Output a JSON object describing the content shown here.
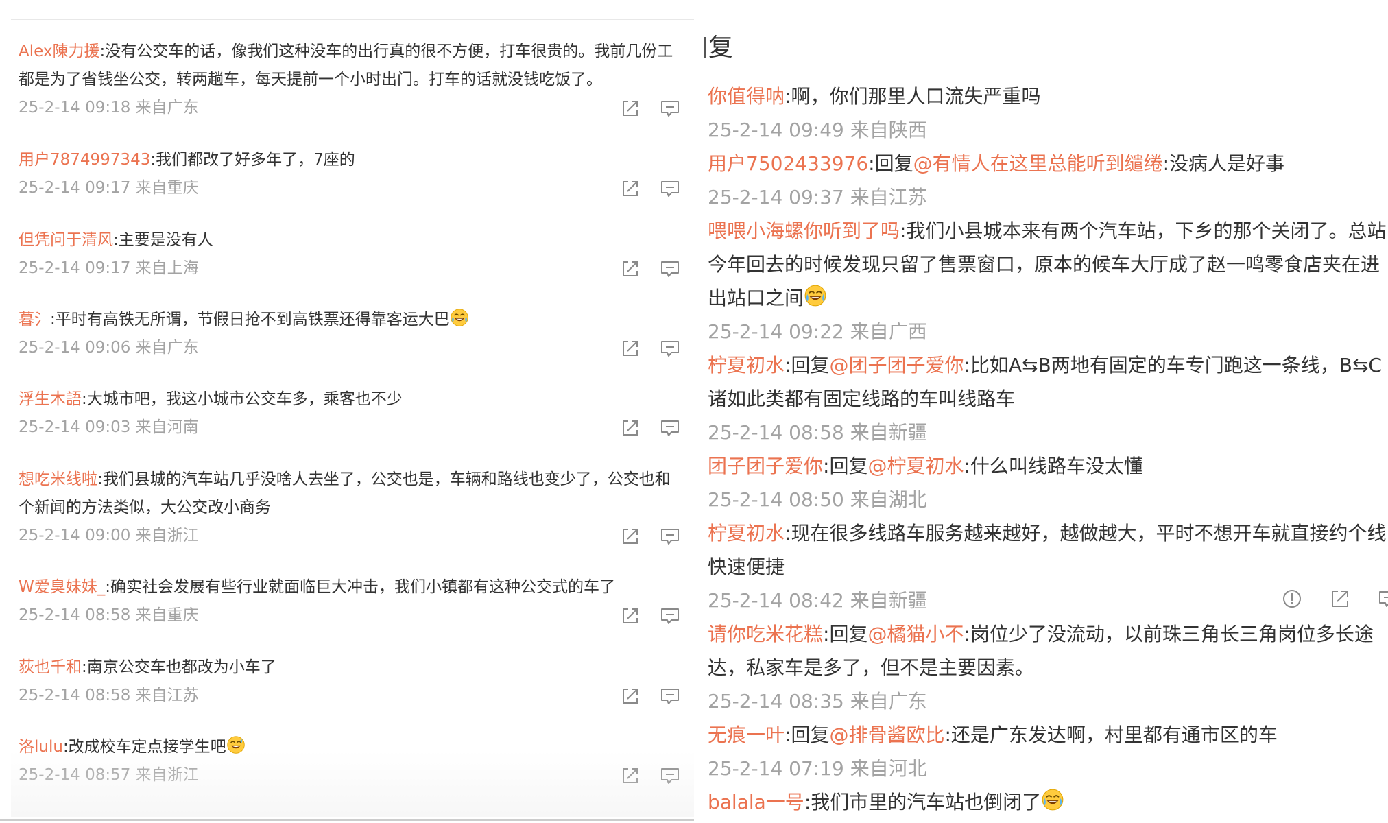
{
  "left_panel": {
    "comments": [
      {
        "user": "Alex陳力援",
        "lines": [
          ":没有公交车的话，像我们这种没车的出行真的很不方便，打车很贵的。我前几份工",
          "都是为了省钱坐公交，转两趟车，每天提前一个小时出门。打车的话就没钱吃饭了。"
        ],
        "meta": "25-2-14 09:18 来自广东"
      },
      {
        "user": "用户7874997343",
        "lines": [
          ":我们都改了好多年了，7座的"
        ],
        "meta": "25-2-14 09:17 来自重庆"
      },
      {
        "user": "但凭问于清风",
        "lines": [
          ":主要是没有人"
        ],
        "meta": "25-2-14 09:17 来自上海"
      },
      {
        "user": "暮氵",
        "lines": [
          ":平时有高铁无所谓，节假日抢不到高铁票还得靠客运大巴"
        ],
        "emoji": "laugh-cry-emoji",
        "meta": "25-2-14 09:06 来自广东"
      },
      {
        "user": "浮生木語",
        "lines": [
          ":大城市吧，我这小城市公交车多，乘客也不少"
        ],
        "meta": "25-2-14 09:03 来自河南"
      },
      {
        "user": "想吃米线啦",
        "lines": [
          ":我们县城的汽车站几乎没啥人去坐了，公交也是，车辆和路线也变少了，公交也和",
          "个新闻的方法类似，大公交改小商务"
        ],
        "meta": "25-2-14 09:00 来自浙江"
      },
      {
        "user": "W爱臭妹妹_",
        "lines": [
          ":确实社会发展有些行业就面临巨大冲击，我们小镇都有这种公交式的车了"
        ],
        "meta": "25-2-14 08:58 来自重庆"
      },
      {
        "user": "荻也千和",
        "lines": [
          ":南京公交车也都改为小车了"
        ],
        "meta": "25-2-14 08:58 来自江苏"
      },
      {
        "user": "洛lulu",
        "lines": [
          ":改成校车定点接学生吧"
        ],
        "emoji": "grin-sweat-emoji",
        "meta": "25-2-14 08:57 来自浙江"
      }
    ]
  },
  "right_panel": {
    "heading": "复",
    "comments": [
      {
        "user": "你值得呐",
        "lines": [
          [
            {
              "t": ":啊，你们那里人口流失严重吗"
            }
          ]
        ],
        "meta": "25-2-14 09:49 来自陕西"
      },
      {
        "user": "用户7502433976",
        "lines": [
          [
            {
              "t": ":回复"
            },
            {
              "t": "@有情人在这里总能听到缱绻",
              "mention": true
            },
            {
              "t": ":没病人是好事"
            }
          ]
        ],
        "meta": "25-2-14 09:37 来自江苏"
      },
      {
        "user": "喂喂小海螺你听到了吗",
        "lines": [
          [
            {
              "t": ":我们小县城本来有两个汽车站，下乡的那个关闭了。总站"
            }
          ],
          [
            {
              "t": "今年回去的时候发现只留了售票窗口，原本的候车大厅成了赵一鸣零食店夹在进"
            }
          ],
          [
            {
              "t": "出站口之间"
            }
          ]
        ],
        "emoji": "laugh-cry-emoji",
        "meta": "25-2-14 09:22 来自广西"
      },
      {
        "user": "柠夏初水",
        "lines": [
          [
            {
              "t": ":回复"
            },
            {
              "t": "@团子团子爱你",
              "mention": true
            },
            {
              "t": ":比如A⇆B两地有固定的车专门跑这一条线，B⇆C"
            }
          ],
          [
            {
              "t": "诸如此类都有固定线路的车叫线路车"
            }
          ]
        ],
        "meta": "25-2-14 08:58 来自新疆"
      },
      {
        "user": "团子团子爱你",
        "lines": [
          [
            {
              "t": ":回复"
            },
            {
              "t": "@柠夏初水",
              "mention": true
            },
            {
              "t": ":什么叫线路车没太懂"
            }
          ]
        ],
        "meta": "25-2-14 08:50 来自湖北"
      },
      {
        "user": "柠夏初水",
        "lines": [
          [
            {
              "t": ":现在很多线路车服务越来越好，越做越大，平时不想开车就直接约个线"
            }
          ],
          [
            {
              "t": "快速便捷"
            }
          ]
        ],
        "meta": "25-2-14 08:42 来自新疆"
      },
      {
        "user": "请你吃米花糕",
        "lines": [
          [
            {
              "t": ":回复"
            },
            {
              "t": "@橘猫小不",
              "mention": true
            },
            {
              "t": ":岗位少了没流动，以前珠三角长三角岗位多长途"
            }
          ],
          [
            {
              "t": "达，私家车是多了，但不是主要因素。"
            }
          ]
        ],
        "meta": "25-2-14 08:35 来自广东"
      },
      {
        "user": "无痕一叶",
        "lines": [
          [
            {
              "t": ":回复"
            },
            {
              "t": "@排骨酱欧比",
              "mention": true
            },
            {
              "t": ":还是广东发达啊，村里都有通市区的车"
            }
          ]
        ],
        "meta": "25-2-14 07:19 来自河北"
      },
      {
        "user": "balala一号",
        "lines": [
          [
            {
              "t": ":我们市里的汽车站也倒闭了"
            }
          ]
        ],
        "emoji": "laugh-cry-emoji"
      }
    ]
  },
  "colors": {
    "username": "#eb7350",
    "body_text": "#333333",
    "meta_text": "#a3a3a3",
    "icon": "#8a8a8a"
  }
}
